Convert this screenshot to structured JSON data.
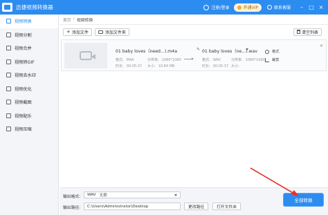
{
  "app": {
    "title": "迅捷视频转换器"
  },
  "titlebar": {
    "login": "注册/登录",
    "vip": "开通VIP",
    "service": "联系客服",
    "min": "–",
    "max": "□",
    "close": "×"
  },
  "sidebar": {
    "items": [
      {
        "label": "视频转换",
        "active": true
      },
      {
        "label": "视频分割"
      },
      {
        "label": "视频合并"
      },
      {
        "label": "视频转GIF"
      },
      {
        "label": "视频去水印"
      },
      {
        "label": "视频优化"
      },
      {
        "label": "视频截图"
      },
      {
        "label": "视频配乐"
      },
      {
        "label": "视频压缩"
      }
    ]
  },
  "breadcrumb": {
    "home": "首页",
    "sep": "›",
    "current": "视频转换"
  },
  "toolbar": {
    "add_file": "添加文件",
    "add_folder": "添加文件夹",
    "clear": "清空列表"
  },
  "file": {
    "source_name": "01 baby loves（need...).m4a",
    "source_format_label": "格式:",
    "source_format": "M4A",
    "source_res_label": "分辨率:",
    "source_res": "1080*1080",
    "source_dur_label": "时长:",
    "source_dur": "00:05:37",
    "source_size_label": "大小:",
    "source_size": "10.84 MB",
    "target_name": "01 baby loves（ne...).wav",
    "target_format_label": "格式:",
    "target_format": "WAV",
    "target_res_label": "分辨率:",
    "target_res": "1080*1080",
    "target_dur_label": "时长:",
    "target_dur": "00:05:37",
    "target_size_label": "大小:",
    "target_size": "",
    "action_format": "格式",
    "action_crop": "裁剪",
    "close": "✕"
  },
  "bottom": {
    "format_label": "输出格式:",
    "format_value": "WAV",
    "format_sub": "无损",
    "path_label": "输出路径:",
    "path_value": "C:\\Users\\Administrator\\Desktop",
    "change_path": "更改路径",
    "open_folder": "打开文件夹",
    "convert_all": "全部转换"
  },
  "colors": {
    "accent": "#2d8cf0",
    "annotation": "#e8312a"
  }
}
